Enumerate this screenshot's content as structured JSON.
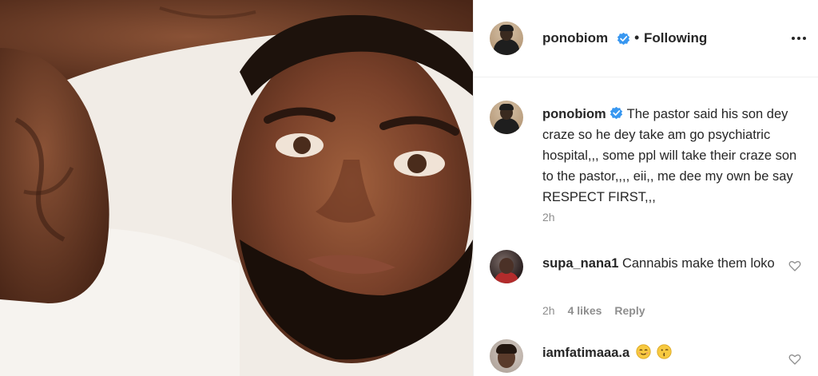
{
  "post": {
    "username": "ponobiom",
    "follow_status": "Following",
    "separator": "•"
  },
  "caption": {
    "username": "ponobiom",
    "text": "The pastor said his son dey craze so he dey take am go psychiatric hospital,,, some ppl will take their craze son to the pastor,,,, eii,, me dee my own be say RESPECT FIRST,,,",
    "time": "2h"
  },
  "comments": [
    {
      "username": "supa_nana1",
      "text": "Cannabis make them loko",
      "time": "2h",
      "likes": "4 likes",
      "reply_label": "Reply"
    },
    {
      "username": "iamfatimaaa.a",
      "text": "",
      "emojis": [
        "relieved-face-emoji",
        "kissing-face-emoji"
      ]
    }
  ],
  "colors": {
    "verified_blue": "#3897f0",
    "text_primary": "#262626",
    "text_secondary": "#8e8e8e",
    "border": "#efefef"
  }
}
